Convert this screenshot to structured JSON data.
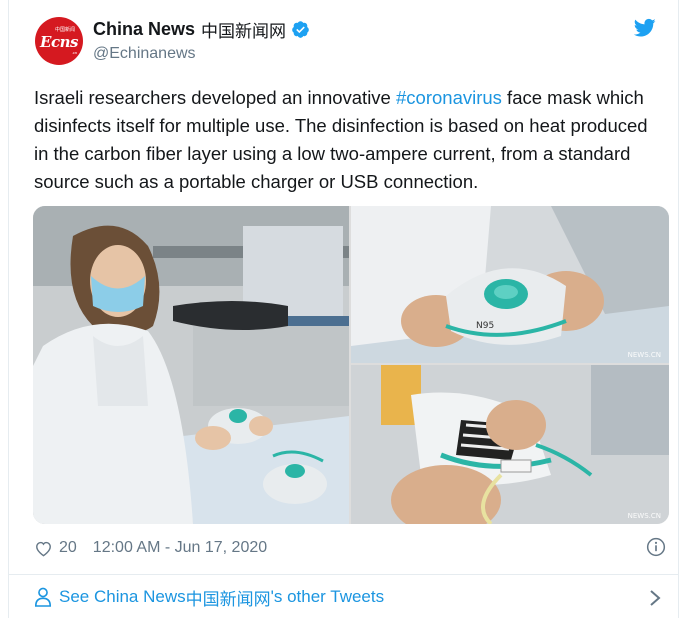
{
  "author": {
    "display_name": "China News",
    "display_name_cn": "中国新闻网",
    "handle": "@Echinanews",
    "avatar_text": "Ecns",
    "avatar_small_cn": "中国新闻",
    "avatar_suffix": ".cn"
  },
  "tweet": {
    "text_before": "Israeli researchers developed an innovative ",
    "hashtag": "#coronavirus",
    "text_after": " face mask which disinfects itself for multiple use. The disinfection is based on heat produced in the carbon fiber layer using a low two-ampere current, from a standard source such as a portable charger or USB connection.",
    "likes": "20",
    "timestamp": "12:00 AM - Jun 17, 2020"
  },
  "media": {
    "watermark": "NEWS.CN"
  },
  "footer": {
    "see_more_prefix": "See China News ",
    "see_more_cn": "中国新闻网",
    "see_more_suffix": "'s other Tweets"
  },
  "colors": {
    "link": "#1b95e0",
    "secondary_text": "#657786",
    "avatar_red": "#d51920",
    "mask_teal": "#2bb5a6"
  },
  "icons": {
    "verified": "verified-badge-icon",
    "bird": "twitter-bird-icon",
    "heart": "heart-icon",
    "info": "info-icon",
    "person": "person-icon",
    "chevron": "chevron-right-icon"
  }
}
